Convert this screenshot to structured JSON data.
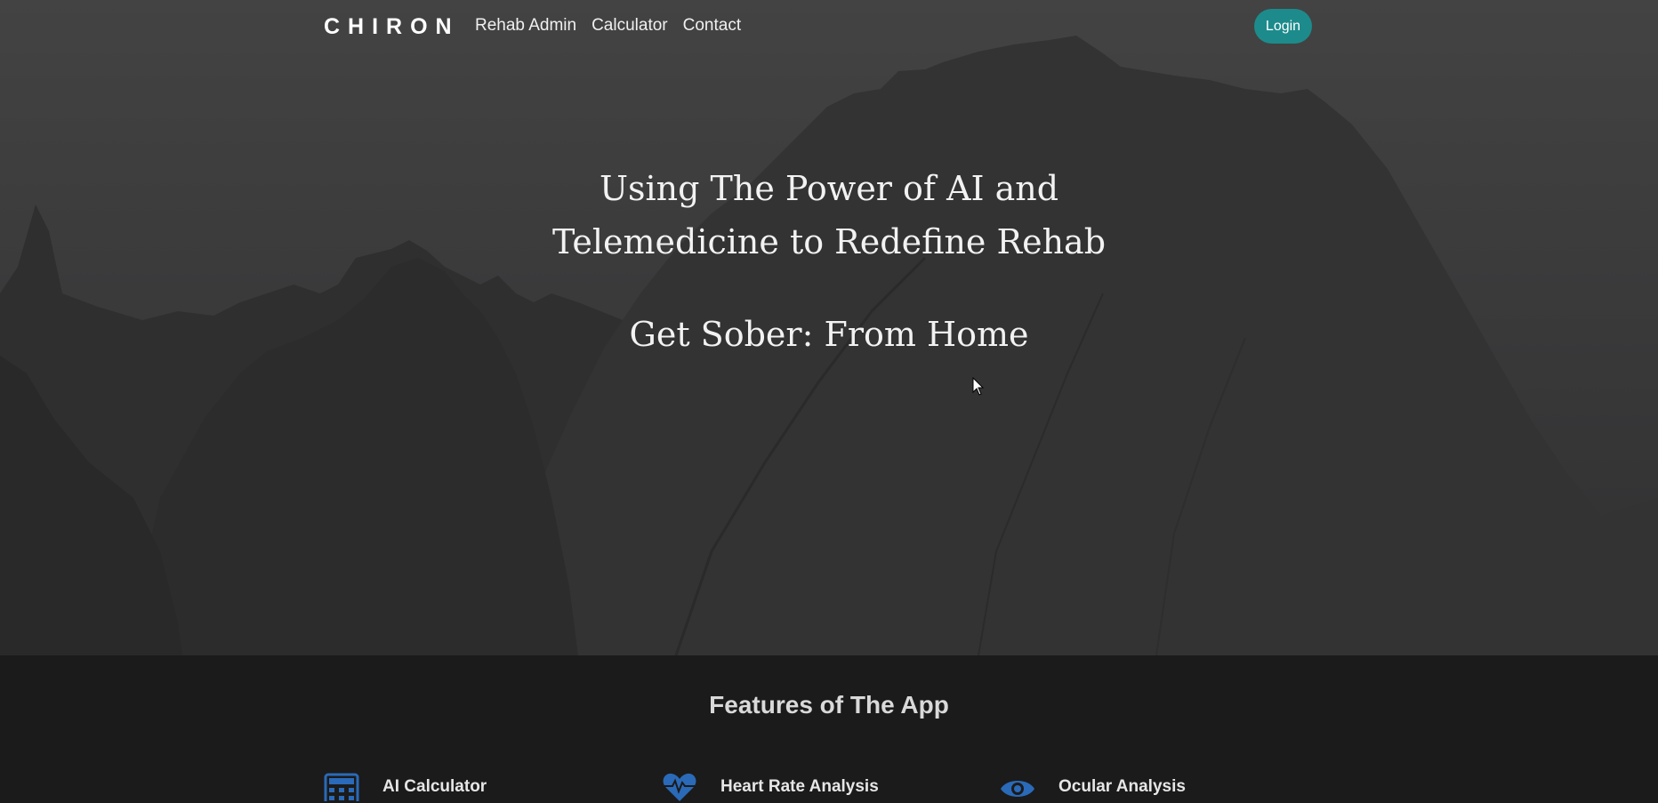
{
  "navbar": {
    "brand": "CHIRON",
    "links": [
      {
        "label": "Rehab Admin"
      },
      {
        "label": "Calculator"
      },
      {
        "label": "Contact"
      }
    ],
    "login_label": "Login"
  },
  "hero": {
    "title_line1": "Using The Power of AI and",
    "title_line2": "Telemedicine to Redefine Rehab",
    "subtitle": "Get Sober: From Home"
  },
  "features": {
    "heading": "Features of The App",
    "items": [
      {
        "label": "AI Calculator",
        "icon": "calculator-icon"
      },
      {
        "label": "Heart Rate Analysis",
        "icon": "heart-rate-icon"
      },
      {
        "label": "Ocular Analysis",
        "icon": "eye-icon"
      }
    ]
  },
  "colors": {
    "accent": "#1d8b8b",
    "icon_blue": "#2a6ab8",
    "hero_bg": "#3d3d3e",
    "features_bg": "#1b1b1b"
  }
}
